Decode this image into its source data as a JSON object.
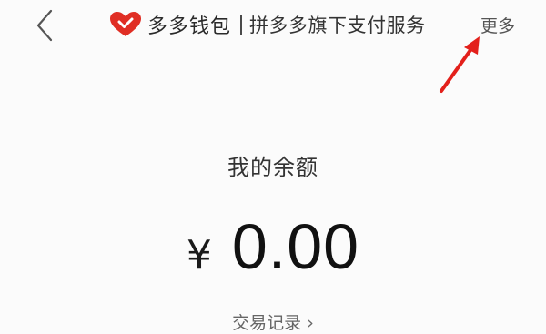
{
  "header": {
    "back_icon": "chevron-left-icon",
    "brand_icon": "heart-icon",
    "brand_color": "#e02e24",
    "brand_name": "多多钱包",
    "brand_subtitle": "拼多多旗下支付服务",
    "more_label": "更多",
    "annotation_color": "#e3201b"
  },
  "balance": {
    "label": "我的余额",
    "currency_symbol": "¥",
    "amount": "0.00"
  },
  "records": {
    "label": "交易记录 ›"
  }
}
